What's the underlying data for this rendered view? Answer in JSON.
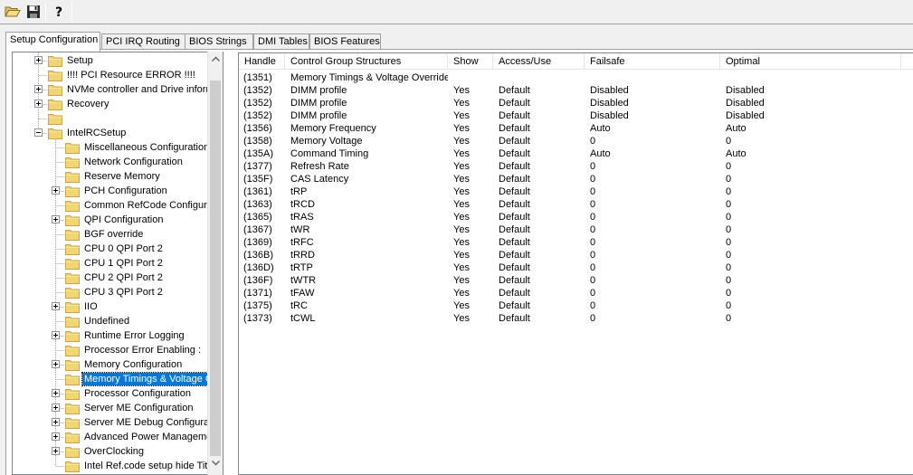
{
  "colors": {
    "selection": "#0078d7",
    "folder": "#f2d573",
    "folder_edge": "#c9a643"
  },
  "toolbar": {
    "open_icon": "folder-open-icon",
    "save_icon": "floppy-disk-icon",
    "help_icon": "help-question-icon"
  },
  "tabs": [
    {
      "label": "Setup Configuration",
      "active": true
    },
    {
      "label": "PCI IRQ Routing"
    },
    {
      "label": "BIOS Strings"
    },
    {
      "label": "DMI Tables"
    },
    {
      "label": "BIOS Features"
    }
  ],
  "tree": {
    "items": [
      {
        "label": "Setup",
        "level": 0,
        "expander": "plus"
      },
      {
        "label": "!!!! PCI Resource ERROR !!!!",
        "level": 0,
        "expander": "none"
      },
      {
        "label": "NVMe controller and Drive informa",
        "level": 0,
        "expander": "plus"
      },
      {
        "label": "Recovery",
        "level": 0,
        "expander": "plus"
      },
      {
        "label": "",
        "level": 0,
        "expander": "none"
      },
      {
        "label": "IntelRCSetup",
        "level": 0,
        "expander": "minus"
      },
      {
        "label": "Miscellaneous Configuration",
        "level": 1,
        "expander": "none"
      },
      {
        "label": "Network Configuration",
        "level": 1,
        "expander": "none"
      },
      {
        "label": "Reserve Memory",
        "level": 1,
        "expander": "none"
      },
      {
        "label": "PCH Configuration",
        "level": 1,
        "expander": "plus"
      },
      {
        "label": "Common RefCode Configurati",
        "level": 1,
        "expander": "none"
      },
      {
        "label": "QPI Configuration",
        "level": 1,
        "expander": "plus"
      },
      {
        "label": "BGF override",
        "level": 1,
        "expander": "none"
      },
      {
        "label": "CPU 0 QPI Port 2",
        "level": 1,
        "expander": "none"
      },
      {
        "label": "CPU 1 QPI Port 2",
        "level": 1,
        "expander": "none"
      },
      {
        "label": "CPU 2 QPI Port 2",
        "level": 1,
        "expander": "none"
      },
      {
        "label": "CPU 3 QPI Port 2",
        "level": 1,
        "expander": "none"
      },
      {
        "label": "IIO",
        "level": 1,
        "expander": "plus"
      },
      {
        "label": "Undefined",
        "level": 1,
        "expander": "none"
      },
      {
        "label": "Runtime Error Logging",
        "level": 1,
        "expander": "plus"
      },
      {
        "label": "Processor Error Enabling :",
        "level": 1,
        "expander": "none"
      },
      {
        "label": "Memory Configuration",
        "level": 1,
        "expander": "plus"
      },
      {
        "label": "Memory Timings & Voltage Ov",
        "level": 1,
        "expander": "none",
        "selected": true
      },
      {
        "label": "Processor Configuration",
        "level": 1,
        "expander": "plus"
      },
      {
        "label": "Server ME Configuration",
        "level": 1,
        "expander": "plus"
      },
      {
        "label": "Server ME Debug Configurati",
        "level": 1,
        "expander": "plus"
      },
      {
        "label": "Advanced Power Manageme",
        "level": 1,
        "expander": "plus"
      },
      {
        "label": "OverClocking",
        "level": 1,
        "expander": "plus"
      },
      {
        "label": "Intel Ref.code setup hide Title",
        "level": 1,
        "expander": "none"
      }
    ]
  },
  "table": {
    "columns": [
      "Handle",
      "Control Group Structures",
      "Show",
      "Access/Use",
      "Failsafe",
      "Optimal"
    ],
    "rows": [
      [
        "(1351)",
        "Memory Timings & Voltage Override",
        "",
        "",
        "",
        ""
      ],
      [
        "(1352)",
        "DIMM profile",
        "Yes",
        "Default",
        "Disabled",
        "Disabled"
      ],
      [
        "(1352)",
        "DIMM profile",
        "Yes",
        "Default",
        "Disabled",
        "Disabled"
      ],
      [
        "(1352)",
        "DIMM profile",
        "Yes",
        "Default",
        "Disabled",
        "Disabled"
      ],
      [
        "(1356)",
        "Memory Frequency",
        "Yes",
        "Default",
        "Auto",
        "Auto"
      ],
      [
        "(1358)",
        "Memory Voltage",
        "Yes",
        "Default",
        "0",
        "0"
      ],
      [
        "(135A)",
        "Command Timing",
        "Yes",
        "Default",
        "Auto",
        "Auto"
      ],
      [
        "(1377)",
        "Refresh Rate",
        "Yes",
        "Default",
        "0",
        "0"
      ],
      [
        "(135F)",
        "CAS Latency",
        "Yes",
        "Default",
        "0",
        "0"
      ],
      [
        "(1361)",
        "tRP",
        "Yes",
        "Default",
        "0",
        "0"
      ],
      [
        "(1363)",
        "tRCD",
        "Yes",
        "Default",
        "0",
        "0"
      ],
      [
        "(1365)",
        "tRAS",
        "Yes",
        "Default",
        "0",
        "0"
      ],
      [
        "(1367)",
        "tWR",
        "Yes",
        "Default",
        "0",
        "0"
      ],
      [
        "(1369)",
        "tRFC",
        "Yes",
        "Default",
        "0",
        "0"
      ],
      [
        "(136B)",
        "tRRD",
        "Yes",
        "Default",
        "0",
        "0"
      ],
      [
        "(136D)",
        "tRTP",
        "Yes",
        "Default",
        "0",
        "0"
      ],
      [
        "(136F)",
        "tWTR",
        "Yes",
        "Default",
        "0",
        "0"
      ],
      [
        "(1371)",
        "tFAW",
        "Yes",
        "Default",
        "0",
        "0"
      ],
      [
        "(1375)",
        "tRC",
        "Yes",
        "Default",
        "0",
        "0"
      ],
      [
        "(1373)",
        "tCWL",
        "Yes",
        "Default",
        "0",
        "0"
      ]
    ]
  }
}
